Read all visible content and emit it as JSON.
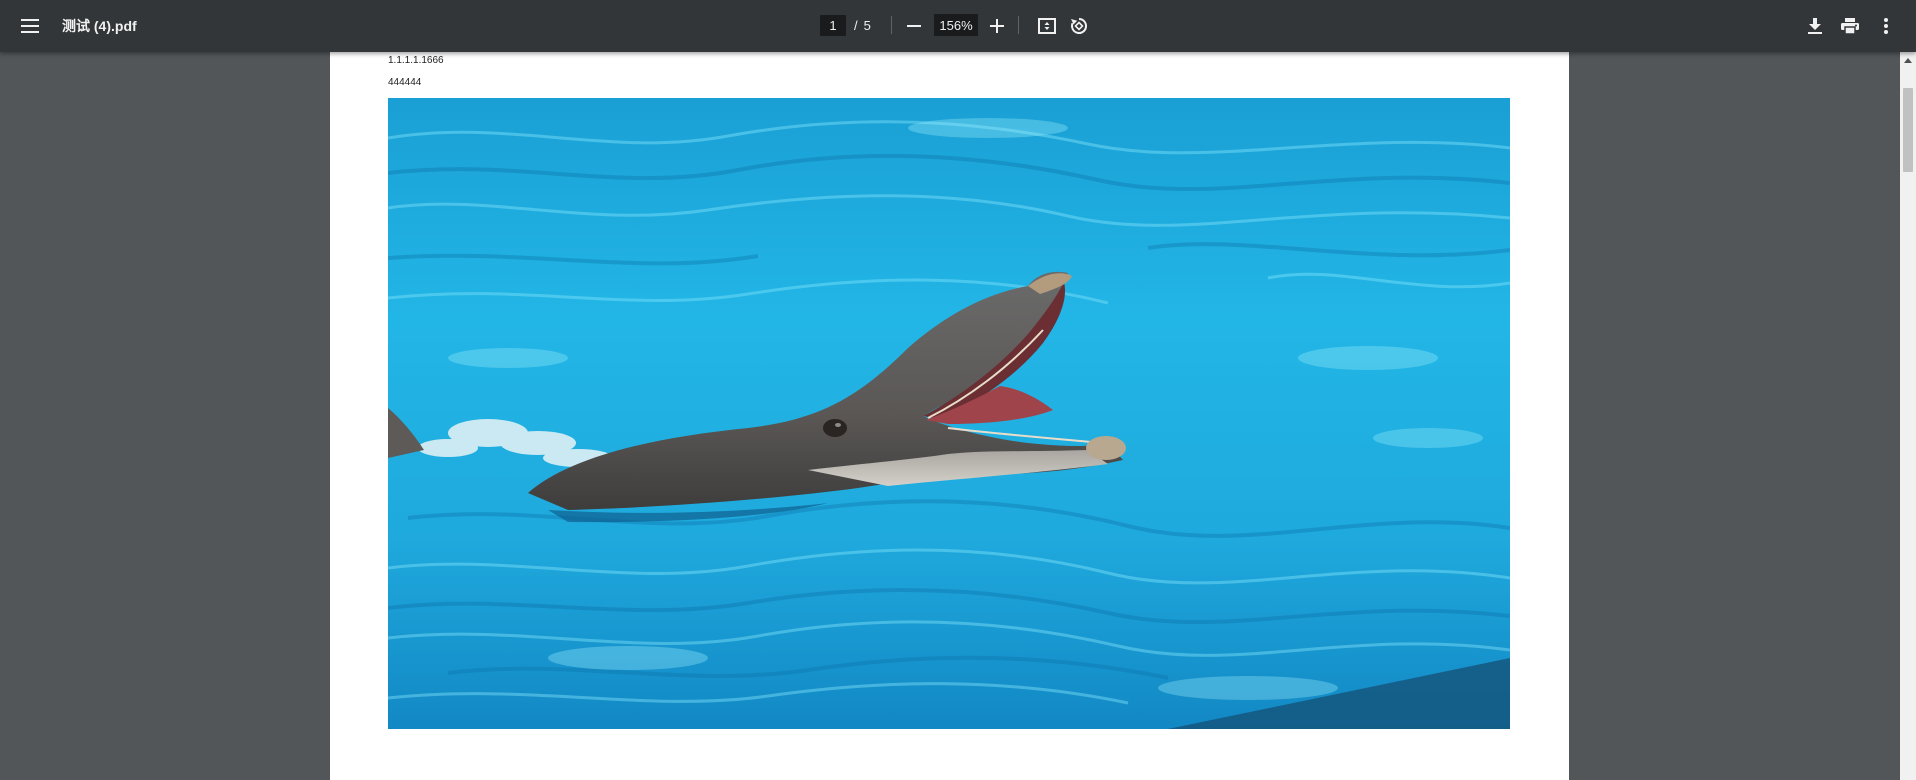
{
  "toolbar": {
    "file_title": "测试 (4).pdf",
    "page_current": "1",
    "page_separator": "/",
    "page_total": "5",
    "zoom_value": "156%"
  },
  "document": {
    "line_1": "1.1.1.1.1666",
    "line_2": "444444",
    "image_subject": "dolphin-in-pool-photo"
  },
  "icons": {
    "menu": "hamburger-icon",
    "zoom_out": "minus-icon",
    "zoom_in": "plus-icon",
    "fit": "fit-to-page-icon",
    "rotate": "rotate-icon",
    "download": "download-icon",
    "print": "print-icon",
    "more": "more-vert-icon"
  },
  "colors": {
    "toolbar_bg": "#323639",
    "viewer_bg": "#525659",
    "toolbar_text": "#f1f1f1",
    "water": "#1fb3e0"
  }
}
